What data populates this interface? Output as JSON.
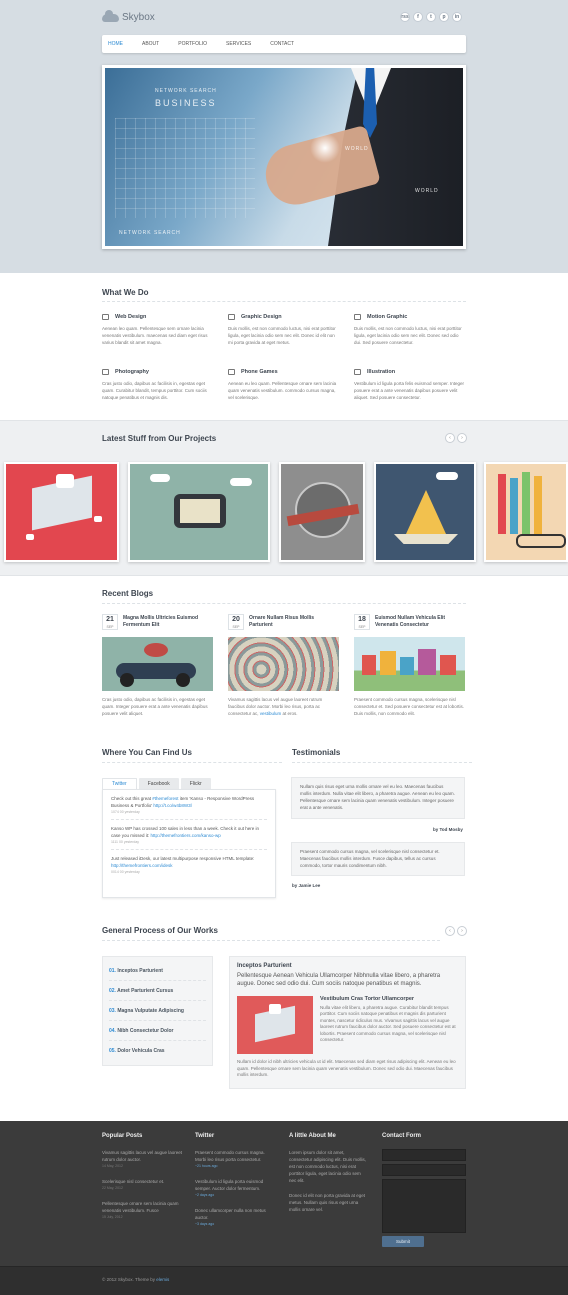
{
  "brand": {
    "name": "Skybox"
  },
  "social": [
    "rss",
    "f",
    "t",
    "p",
    "in"
  ],
  "nav": [
    {
      "label": "HOME",
      "active": true
    },
    {
      "label": "ABOUT"
    },
    {
      "label": "PORTFOLIO"
    },
    {
      "label": "SERVICES"
    },
    {
      "label": "CONTACT"
    }
  ],
  "hero": {
    "texts": [
      "NETWORK SEARCH",
      "BUSINESS",
      "WORLD",
      "NETWORK SEARCH",
      "WORLD"
    ]
  },
  "what_we_do": {
    "title": "What We Do",
    "items": [
      {
        "icon": "monitor-icon",
        "title": "Web Design",
        "text": "Aenean leo quam. Pellentesque sem ornare lacinia venenatis vestibulum. maecenas sed diam eget risus varius blandit sit amet magna."
      },
      {
        "icon": "briefcase-icon",
        "title": "Graphic Design",
        "text": "Duis mollis, est non commodo luctus, nisi erat porttitor ligula, eget lacinia odio sem nec elit. Donec id elit non mi porta gravida at eget metus."
      },
      {
        "icon": "book-icon",
        "title": "Motion Graphic",
        "text": "Duis mollis, est non commodo luctus, nisi erat porttitor ligula, eget lacinia odio sem nec elit. Donec sed odio dui. Sed posuere consectetur."
      },
      {
        "icon": "camera-icon",
        "title": "Photography",
        "text": "Cras justo odio, dapibus ac facilisis in, egestas eget quam. Curabitur blandit, tempus porttitor. Cum sociis natoque penatibus et magnis dis."
      },
      {
        "icon": "phone-icon",
        "title": "Phone Games",
        "text": "Aenean eu leo quam. Pellentesque ornare sem lacinia quam venenatis vestibulum. commodo cursus magna, vel scelerisque."
      },
      {
        "icon": "pencil-icon",
        "title": "Illustration",
        "text": "Vestibulum id ligula porta felis euismod semper. Integer posuere erat a ante venenatis dapibus posuere velit aliquet. Sed posuere consectetur."
      }
    ]
  },
  "projects": {
    "title": "Latest Stuff from Our Projects"
  },
  "blogs": {
    "title": "Recent Blogs",
    "items": [
      {
        "day": "21",
        "month": "SEP",
        "title": "Magna Mollis Ultricies Euismod Fermentum Elit",
        "text_a": "Cras justo odio, dapibus ac facilisis in, egestas eget quam. Integer posuere erat a ante venenatis dapibus posuere velit aliquet.",
        "link": ""
      },
      {
        "day": "20",
        "month": "SEP",
        "title": "Ornare Nullam Risus Mollis Parturient",
        "text_a": "Vivamus sagittis lacus vel augue laoreet rutrum faucibus dolor auctor. Morbi leo risus, porta ac consectetur ac, ",
        "link": "vestibulum",
        "text_b": " at eros."
      },
      {
        "day": "18",
        "month": "SEP",
        "title": "Euismod Nullam Vehicula Elit Venenatis Consectetur",
        "text_a": "Praesent commodo cursus magna, scelerisque nisl consectetur et. Sed posuere consectetur est at lobortis. Duis mollis, non commodo elit.",
        "link": ""
      }
    ]
  },
  "find_us": {
    "title": "Where You Can Find Us",
    "tabs": [
      {
        "label": "Twitter",
        "active": true
      },
      {
        "label": "Facebook"
      },
      {
        "label": "Flickr"
      }
    ],
    "tweets": [
      {
        "a": "Check out this great ",
        "link1": "#themeforest",
        "b": " item 'Kanso - Responsive WordPress Business & Portfolio' ",
        "link2": "http://t.co/w4b8W3l",
        "when": "1074 00 yesterday"
      },
      {
        "a": "Kanso WP has crossed 100 sales in less than a week. Check it out here in case you missed it: ",
        "link1": "http://themefrontiers.com/kanso-wp",
        "b": "",
        "link2": "",
        "when": "1111 00 yesterday"
      },
      {
        "a": "Just released iDesk, our latest multipurpose responsive HTML template: ",
        "link1": "http://themefrontiers.com/idesk",
        "b": "",
        "link2": "",
        "when": "0014 00 yesterday"
      }
    ]
  },
  "testimonials": {
    "title": "Testimonials",
    "items": [
      {
        "text": "Nullam quis risus eget urna mollis ornare vel eu leo. Maecenas faucibus mollis interdum. Nulla vitae elit libero, a pharetra augue. Aenean eu leo quam. Pellentesque ornare sem lacinia quam venenatis vestibulum. Integer posuere erat a ante venenatis.",
        "author": "by Tod Mosby"
      },
      {
        "text": "Praesent commodo cursus magna, vel scelerisque nisl consectetur et. Maecenas faucibus mollis interdum. Fusce dapibus, tellus ac cursus commodo, tortor mauris condimentum nibh.",
        "author": "by Jamie Lee"
      }
    ]
  },
  "process": {
    "title": "General Process of Our Works",
    "steps": [
      {
        "num": "01.",
        "label": "Inceptos Parturient"
      },
      {
        "num": "02.",
        "label": "Amet Parturient Cursus"
      },
      {
        "num": "03.",
        "label": "Magna Vulputate Adipiscing"
      },
      {
        "num": "04.",
        "label": "Nibh Consectetur Dolor"
      },
      {
        "num": "05.",
        "label": "Dolor Vehicula Cras"
      }
    ],
    "panel": {
      "title": "Inceptos Parturient",
      "lead": "Pellentesque Aenean Vehicula Ullamcorper Nibhnulla vitae libero, a pharetra augue. Donec sed odio dui. Cum sociis natoque penatibus et magnis.",
      "sub_title": "Vestibulum Cras Tortor Ullamcorper",
      "sub_text": "Nulla vitae elit libero, a pharetra augue. Curabitur blandit tempus porttitor. Cum sociis natoque penatibus et magnis dis parturient montes, nascetur ridiculus mus. Vivamus sagittis lacus vel augue laoreet rutrum faucibus dolor auctor. Sed posuere consectetur est at lobortis. Praesent commodo cursus magna, vel scelerisque nisl consectetur.",
      "bottom": "Nullam id dolor id nibh ultricies vehicula ut id elit. Maecenas sed diam eget risus adipiscing elit. Aenean eu leo quam. Pellentesque ornare sem lacinia quam venenatis vestibulum. Donec sed odio dui. Maecenas faucibus mollis interdum."
    }
  },
  "footer": {
    "popular": {
      "title": "Popular Posts",
      "items": [
        {
          "text": "Vivamus sagittis lacus vel augue laoreet rutrum dolor auctor.",
          "date": "14 May, 2012"
        },
        {
          "text": "Scelerisque nisl consectetur et.",
          "date": "22 May, 2012"
        },
        {
          "text": "Pellentesque ornare sem lacinia quam venenatis vestibulum. Fusce",
          "date": "15 July, 2012"
        }
      ]
    },
    "twitter": {
      "title": "Twitter",
      "items": [
        {
          "text": "Praesent commodo cursus magna. Morbi leo risus porta consectetur.",
          "time": "~21 hours ago"
        },
        {
          "text": "Vestibulum id ligula porta euismod semper. Auctor dolor fermentum.",
          "time": "~2 days ago"
        },
        {
          "text": "Donec ullamcorper nulla non metus auctor.",
          "time": "~3 days ago"
        }
      ]
    },
    "about": {
      "title": "A little About Me",
      "p1": "Lorem ipsum dolor sit amet, consectetur adipiscing elit. Duis mollis, est non commodo luctus, nisi erat porttitor ligula, eget lacinia odio sem nec elit.",
      "p2": "Donec id elit non porta gravida at eget metus. Nullam quis risus eget urna mollis ornare vel."
    },
    "contact": {
      "title": "Contact Form",
      "submit": "Submit"
    },
    "copyright": "© 2012 Skybox. Theme by ",
    "author": "elemis"
  }
}
